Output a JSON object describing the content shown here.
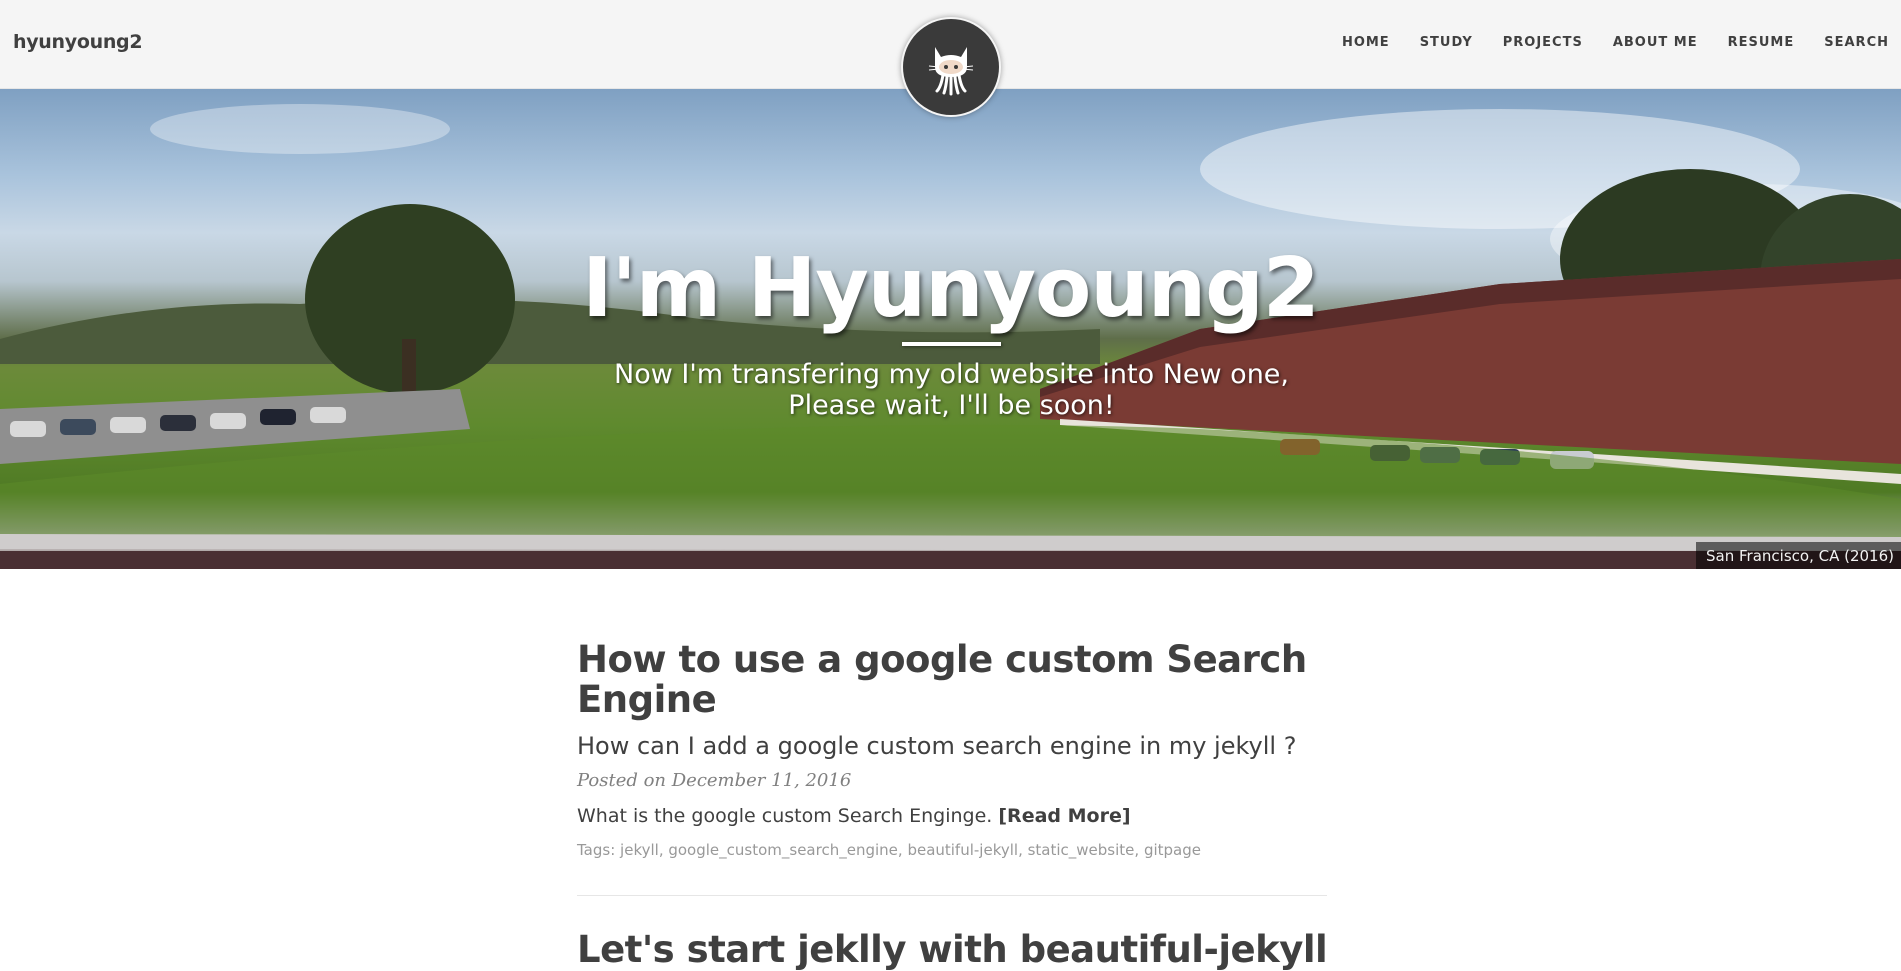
{
  "navbar": {
    "brand": "hyunyoung2",
    "links": [
      "HOME",
      "STUDY",
      "PROJECTS",
      "ABOUT ME",
      "RESUME",
      "SEARCH"
    ],
    "avatar_icon": "github-octocat-icon"
  },
  "hero": {
    "title": "I'm Hyunyoung2",
    "subtitle": "Now I'm transfering my old website into New one, Please wait, I'll be soon!",
    "caption": "San Francisco, CA (2016)"
  },
  "posts": [
    {
      "title": "How to use a google custom Search Engine",
      "subtitle": "How can I add a google custom search engine in my jekyll ?",
      "meta": "Posted on December 11, 2016",
      "excerpt": "What is the google custom Search Enginge.",
      "read_more": "[Read More]",
      "tags_label": "Tags:",
      "tags": [
        "jekyll",
        "google_custom_search_engine",
        "beautiful-jekyll",
        "static_website",
        "gitpage"
      ]
    },
    {
      "title": "Let's start jeklly with beautiful-jekyll"
    }
  ],
  "colors": {
    "text": "#404040",
    "navbar_bg": "#f5f5f5",
    "muted": "#808080",
    "tag": "#999999"
  }
}
